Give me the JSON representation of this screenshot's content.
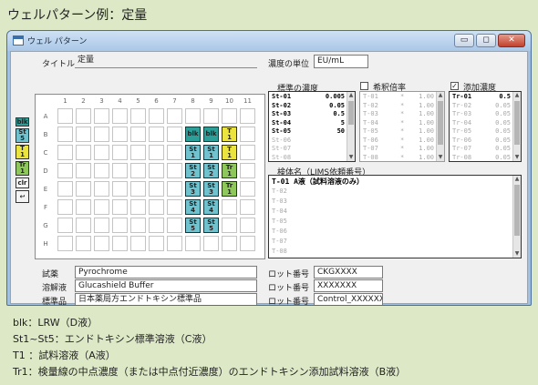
{
  "heading": "ウェルパターン例：定量",
  "window": {
    "title": "ウェル パターン"
  },
  "titlebar_buttons": {
    "min": "▭",
    "max": "◻",
    "close": "✕"
  },
  "form": {
    "title_label": "タイトル",
    "title_value": "定量",
    "unit_label": "濃度の単位",
    "unit_value": "EU/mL"
  },
  "legend": [
    {
      "label": "blk",
      "color": "#2e9f98"
    },
    {
      "label": "St\n5",
      "color": "#6fc2ce"
    },
    {
      "label": "T\n1",
      "color": "#ebe43e"
    },
    {
      "label": "Tr\n1",
      "color": "#8ec85a"
    },
    {
      "label": "clr",
      "color": "#f4f4f4"
    },
    {
      "label": "↩",
      "color": "#f4f4f4"
    }
  ],
  "plate": {
    "cols": [
      "1",
      "2",
      "3",
      "4",
      "5",
      "6",
      "7",
      "8",
      "9",
      "10",
      "11"
    ],
    "rows": [
      "A",
      "B",
      "C",
      "D",
      "E",
      "F",
      "G",
      "H"
    ],
    "wells": [
      {
        "label": "blk",
        "color": "#2e9f98",
        "row": 1,
        "col": 7
      },
      {
        "label": "blk",
        "color": "#2e9f98",
        "row": 1,
        "col": 8
      },
      {
        "label": "T\n1",
        "color": "#ebe43e",
        "row": 1,
        "col": 9
      },
      {
        "label": "St\n1",
        "color": "#6fc2ce",
        "row": 2,
        "col": 7
      },
      {
        "label": "St\n1",
        "color": "#6fc2ce",
        "row": 2,
        "col": 8
      },
      {
        "label": "T\n1",
        "color": "#ebe43e",
        "row": 2,
        "col": 9
      },
      {
        "label": "St\n2",
        "color": "#6fc2ce",
        "row": 3,
        "col": 7
      },
      {
        "label": "St\n2",
        "color": "#6fc2ce",
        "row": 3,
        "col": 8
      },
      {
        "label": "Tr\n1",
        "color": "#8ec85a",
        "row": 3,
        "col": 9
      },
      {
        "label": "St\n3",
        "color": "#6fc2ce",
        "row": 4,
        "col": 7
      },
      {
        "label": "St\n3",
        "color": "#6fc2ce",
        "row": 4,
        "col": 8
      },
      {
        "label": "Tr\n1",
        "color": "#8ec85a",
        "row": 4,
        "col": 9
      },
      {
        "label": "St\n4",
        "color": "#6fc2ce",
        "row": 5,
        "col": 7
      },
      {
        "label": "St\n4",
        "color": "#6fc2ce",
        "row": 5,
        "col": 8
      },
      {
        "label": "St\n5",
        "color": "#6fc2ce",
        "row": 6,
        "col": 7
      },
      {
        "label": "St\n5",
        "color": "#6fc2ce",
        "row": 6,
        "col": 8
      }
    ]
  },
  "std_conc": {
    "label": "標準の濃度",
    "rows": [
      {
        "name": "St-01",
        "value": "0.005",
        "active": true
      },
      {
        "name": "St-02",
        "value": "0.05",
        "active": true
      },
      {
        "name": "St-03",
        "value": "0.5",
        "active": true
      },
      {
        "name": "St-04",
        "value": "5",
        "active": true
      },
      {
        "name": "St-05",
        "value": "50",
        "active": true
      },
      {
        "name": "St-06",
        "value": "",
        "active": false
      },
      {
        "name": "St-07",
        "value": "",
        "active": false
      },
      {
        "name": "St-08",
        "value": "",
        "active": false
      }
    ]
  },
  "dilution": {
    "label": "希釈倍率",
    "checked": false,
    "check_mark": "",
    "rows": [
      {
        "name": "T-01",
        "value": "1.00"
      },
      {
        "name": "T-02",
        "value": "1.00"
      },
      {
        "name": "T-03",
        "value": "1.00"
      },
      {
        "name": "T-04",
        "value": "1.00"
      },
      {
        "name": "T-05",
        "value": "1.00"
      },
      {
        "name": "T-06",
        "value": "1.00"
      },
      {
        "name": "T-07",
        "value": "1.00"
      },
      {
        "name": "T-08",
        "value": "1.00"
      }
    ]
  },
  "spike": {
    "label": "添加濃度",
    "checked": true,
    "check_mark": "✓",
    "rows": [
      {
        "name": "Tr-01",
        "value": "0.5",
        "active": true
      },
      {
        "name": "Tr-02",
        "value": "0.05",
        "active": false
      },
      {
        "name": "Tr-03",
        "value": "0.05",
        "active": false
      },
      {
        "name": "Tr-04",
        "value": "0.05",
        "active": false
      },
      {
        "name": "Tr-05",
        "value": "0.05",
        "active": false
      },
      {
        "name": "Tr-06",
        "value": "0.05",
        "active": false
      },
      {
        "name": "Tr-07",
        "value": "0.05",
        "active": false
      },
      {
        "name": "Tr-08",
        "value": "0.05",
        "active": false
      }
    ]
  },
  "samples": {
    "label": "検体名（LIMS依頼番号）",
    "rows": [
      {
        "text": "T-01  A液（試料溶液のみ）",
        "active": true
      },
      {
        "text": "T-02",
        "active": false
      },
      {
        "text": "T-03",
        "active": false
      },
      {
        "text": "T-04",
        "active": false
      },
      {
        "text": "T-05",
        "active": false
      },
      {
        "text": "T-06",
        "active": false
      },
      {
        "text": "T-07",
        "active": false
      },
      {
        "text": "T-08",
        "active": false
      }
    ]
  },
  "reagents": [
    {
      "label": "試薬",
      "value": "Pyrochrome",
      "lot_label": "ロット番号",
      "lot_value": "CKGXXXX"
    },
    {
      "label": "溶解液",
      "value": "Glucashield Buffer",
      "lot_label": "ロット番号",
      "lot_value": "XXXXXXX"
    },
    {
      "label": "標準品",
      "value": "日本薬局方エンドトキシン標準品",
      "lot_label": "ロット番号",
      "lot_value": "Control_XXXXXXX"
    }
  ],
  "footnotes": [
    "blk：LRW（D液）",
    "St1~St5：エンドトキシン標準溶液（C液）",
    "T1 ：試料溶液（A液）",
    "Tr1：検量線の中点濃度（または中点付近濃度）のエンドトキシン添加試料溶液（B液）"
  ]
}
